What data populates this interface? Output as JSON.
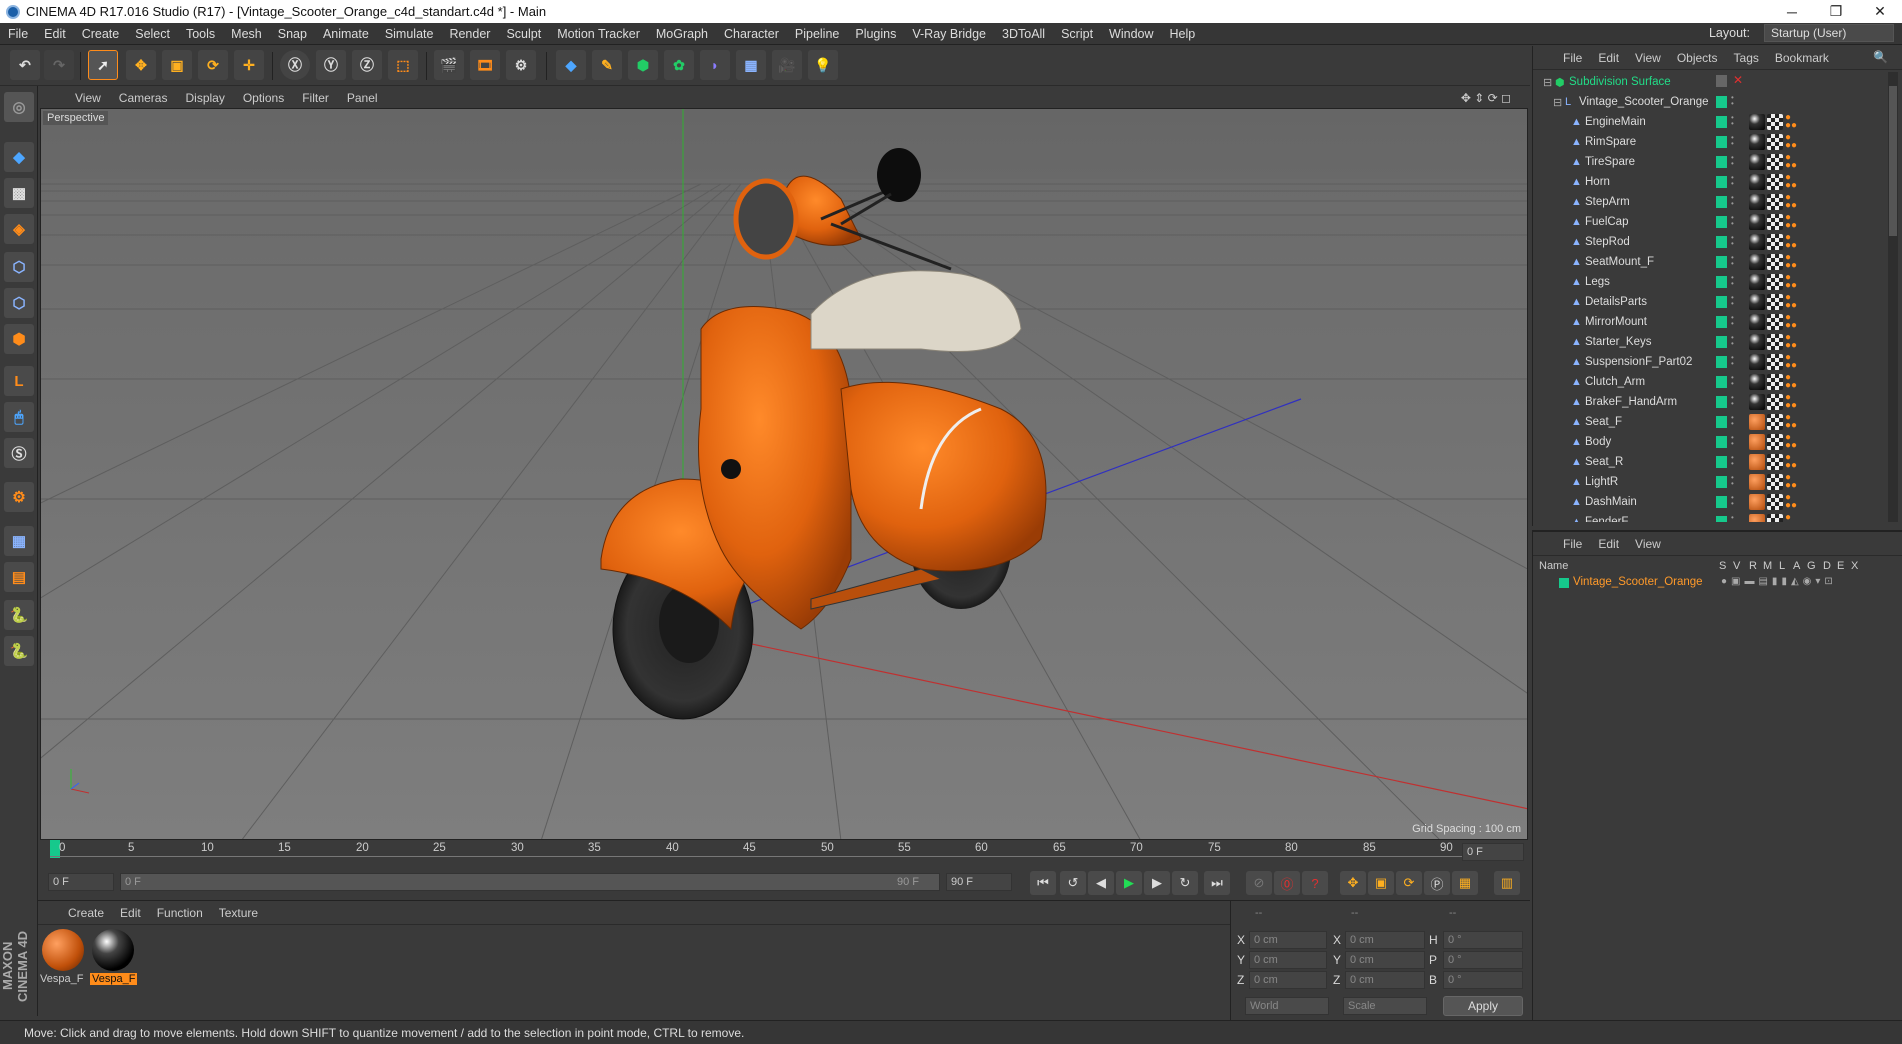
{
  "window": {
    "title": "CINEMA 4D R17.016 Studio (R17) - [Vintage_Scooter_Orange_c4d_standart.c4d *] - Main",
    "min": "─",
    "max": "❐",
    "close": "✕"
  },
  "menu": [
    "File",
    "Edit",
    "Create",
    "Select",
    "Tools",
    "Mesh",
    "Snap",
    "Animate",
    "Simulate",
    "Render",
    "Sculpt",
    "Motion Tracker",
    "MoGraph",
    "Character",
    "Pipeline",
    "Plugins",
    "V-Ray Bridge",
    "3DToAll",
    "Script",
    "Window",
    "Help"
  ],
  "layout": {
    "label": "Layout:",
    "value": "Startup (User)"
  },
  "viewport": {
    "menu": [
      "View",
      "Cameras",
      "Display",
      "Options",
      "Filter",
      "Panel"
    ],
    "label": "Perspective",
    "grid_spacing": "Grid Spacing : 100 cm"
  },
  "timeline": {
    "ticks": [
      "0",
      "5",
      "10",
      "15",
      "20",
      "25",
      "30",
      "35",
      "40",
      "45",
      "50",
      "55",
      "60",
      "65",
      "70",
      "75",
      "80",
      "85",
      "90"
    ],
    "current": "0 F",
    "start": "0 F",
    "range_start": "0 F",
    "range_end": "90 F",
    "end": "90 F"
  },
  "material": {
    "menu": [
      "Create",
      "Edit",
      "Function",
      "Texture"
    ],
    "items": [
      {
        "name": "Vespa_F"
      },
      {
        "name": "Vespa_F"
      }
    ]
  },
  "coords": {
    "headers": [
      "--",
      "--",
      "--"
    ],
    "rows": [
      {
        "a": "X",
        "av": "0 cm",
        "b": "X",
        "bv": "0 cm",
        "c": "H",
        "cv": "0 °"
      },
      {
        "a": "Y",
        "av": "0 cm",
        "b": "Y",
        "bv": "0 cm",
        "c": "P",
        "cv": "0 °"
      },
      {
        "a": "Z",
        "av": "0 cm",
        "b": "Z",
        "bv": "0 cm",
        "c": "B",
        "cv": "0 °"
      }
    ],
    "world": "World",
    "scale": "Scale",
    "apply": "Apply"
  },
  "objects": {
    "menu": [
      "File",
      "Edit",
      "View",
      "Objects",
      "Tags",
      "Bookmark"
    ],
    "root": "Subdivision Surface",
    "group": "Vintage_Scooter_Orange",
    "items": [
      {
        "name": "EngineMain",
        "mat": "black"
      },
      {
        "name": "RimSpare",
        "mat": "black"
      },
      {
        "name": "TireSpare",
        "mat": "black"
      },
      {
        "name": "Horn",
        "mat": "black"
      },
      {
        "name": "StepArm",
        "mat": "black"
      },
      {
        "name": "FuelCap",
        "mat": "black"
      },
      {
        "name": "StepRod",
        "mat": "black"
      },
      {
        "name": "SeatMount_F",
        "mat": "black"
      },
      {
        "name": "Legs",
        "mat": "black"
      },
      {
        "name": "DetailsParts",
        "mat": "black"
      },
      {
        "name": "MirrorMount",
        "mat": "black"
      },
      {
        "name": "Starter_Keys",
        "mat": "black"
      },
      {
        "name": "SuspensionF_Part02",
        "mat": "black"
      },
      {
        "name": "Clutch_Arm",
        "mat": "black"
      },
      {
        "name": "BrakeF_HandArm",
        "mat": "black"
      },
      {
        "name": "Seat_F",
        "mat": "orange"
      },
      {
        "name": "Body",
        "mat": "orange"
      },
      {
        "name": "Seat_R",
        "mat": "orange"
      },
      {
        "name": "LightR",
        "mat": "orange"
      },
      {
        "name": "DashMain",
        "mat": "orange"
      },
      {
        "name": "FenderF",
        "mat": "orange"
      }
    ]
  },
  "attributes": {
    "menu": [
      "File",
      "Edit",
      "View"
    ],
    "columns": [
      "Name",
      "S",
      "V",
      "R",
      "M",
      "L",
      "A",
      "G",
      "D",
      "E",
      "X"
    ],
    "row": "Vintage_Scooter_Orange"
  },
  "status": "Move: Click and drag to move elements. Hold down SHIFT to quantize movement / add to the selection in point mode, CTRL to remove.",
  "colors": {
    "accent": "#ff8c1a",
    "green": "#16c98c",
    "orange_paint": "#e0620e"
  }
}
